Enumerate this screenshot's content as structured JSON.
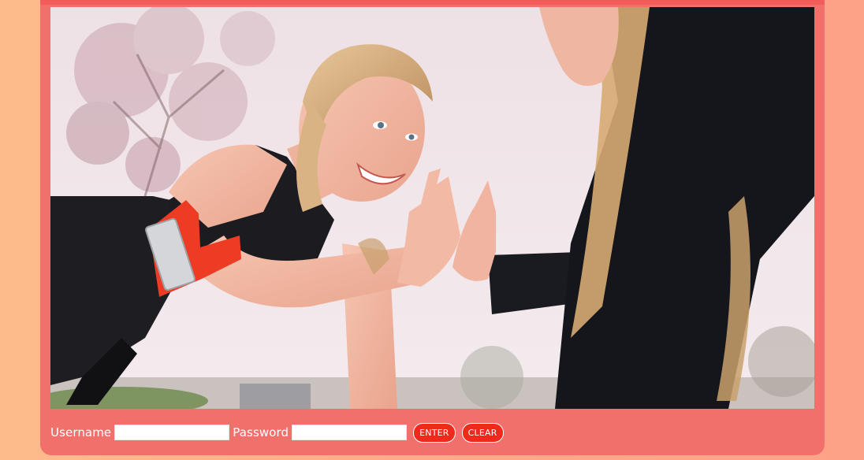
{
  "photo": {
    "alt": "Two women exercising outdoors giving a high five"
  },
  "login": {
    "username_label": "Username",
    "username_value": "",
    "password_label": "Password",
    "password_value": "",
    "enter_label": "ENTER",
    "clear_label": "CLEAR"
  },
  "colors": {
    "background_left": "#fdbb8b",
    "background_right": "#fea287",
    "panel": "#f2706c",
    "panel_border": "#f45c5c",
    "button": "#ef2a1c"
  }
}
